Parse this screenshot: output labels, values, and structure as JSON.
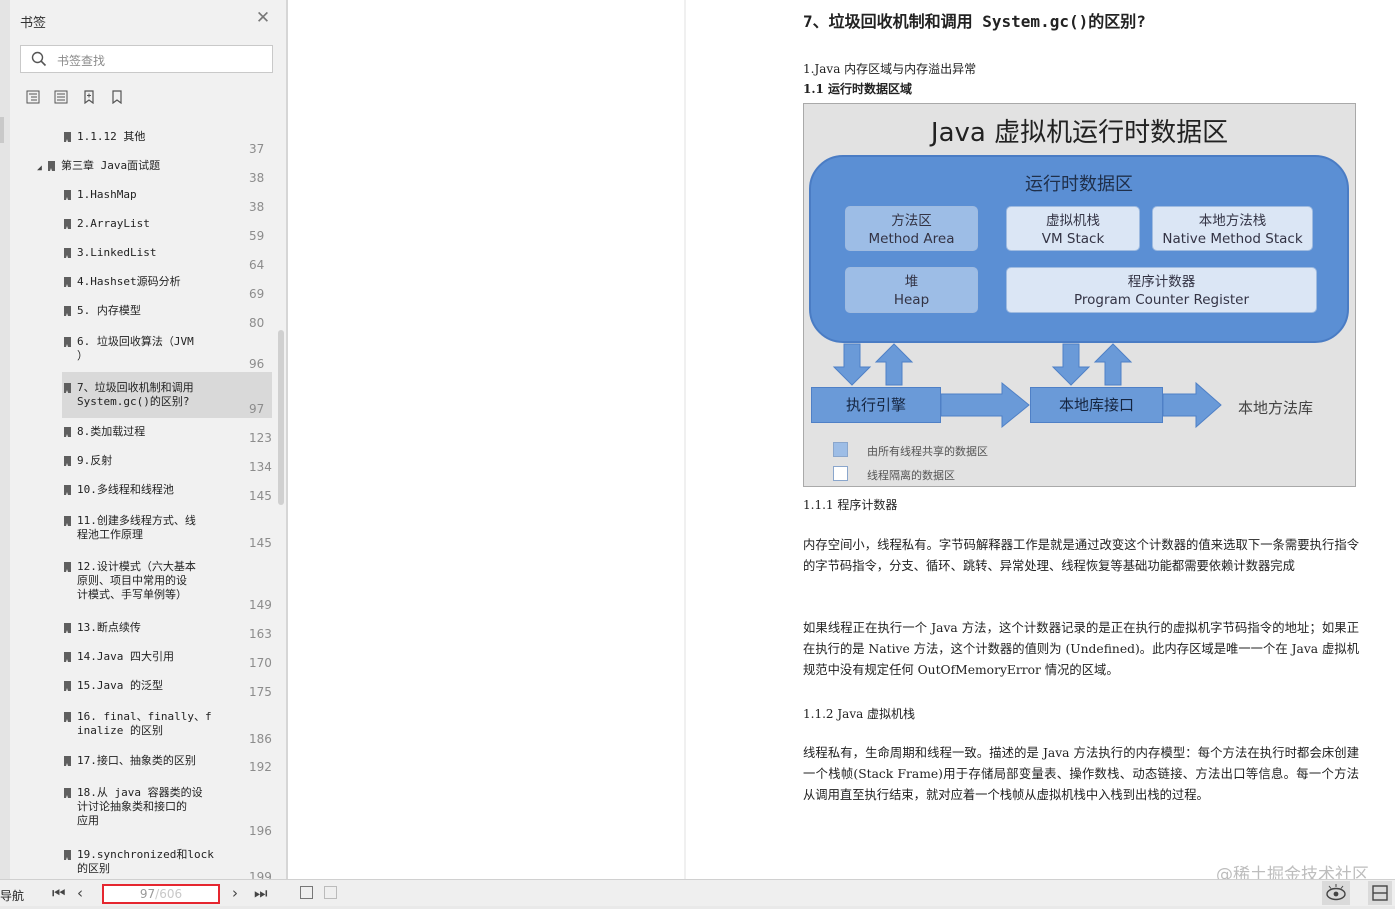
{
  "sidebar": {
    "title": "书签",
    "search_placeholder": "书签查找",
    "bookmarks": [
      {
        "label": "1.1.12 其他",
        "page": "37"
      },
      {
        "label": "第三章 Java面试题",
        "page": "38"
      },
      {
        "label": "1.HashMap",
        "page": "38"
      },
      {
        "label": "2.ArrayList",
        "page": "59"
      },
      {
        "label": "3.LinkedList",
        "page": "64"
      },
      {
        "label": "4.Hashset源码分析",
        "page": "69"
      },
      {
        "label": "5. 内存模型",
        "page": "80"
      },
      {
        "label": "6. 垃圾回收算法（JVM\n）",
        "page": "96"
      },
      {
        "label": "7、垃圾回收机制和调用\nSystem.gc()的区别?",
        "page": "97"
      },
      {
        "label": "8.类加载过程",
        "page": "123"
      },
      {
        "label": "9.反射",
        "page": "134"
      },
      {
        "label": "10.多线程和线程池",
        "page": "145"
      },
      {
        "label": "11.创建多线程方式、线\n程池工作原理",
        "page": "145"
      },
      {
        "label": "12.设计模式（六大基本\n原则、项目中常用的设\n计模式、手写单例等）",
        "page": "149"
      },
      {
        "label": "13.断点续传",
        "page": "163"
      },
      {
        "label": "14.Java 四大引用",
        "page": "170"
      },
      {
        "label": "15.Java 的泛型",
        "page": "175"
      },
      {
        "label": "16. final、finally、f\ninalize 的区别",
        "page": "186"
      },
      {
        "label": "17.接口、抽象类的区别",
        "page": "192"
      },
      {
        "label": "18.从 java 容器类的设\n计讨论抽象类和接口的\n应用",
        "page": "196"
      },
      {
        "label": "19.synchronized和lock\n的区别",
        "page": "199"
      }
    ]
  },
  "document": {
    "heading": "7、垃圾回收机制和调用 System.gc()的区别?",
    "section_1": "1.Java 内存区域与内存溢出异常",
    "section_1_1": "1.1  运行时数据区域",
    "figure": {
      "title": "Java 虚拟机运行时数据区",
      "runtime_area": "运行时数据区",
      "method_area": "方法区\nMethod Area",
      "vm_stack": "虚拟机栈\nVM Stack",
      "native_stack": "本地方法栈\nNative Method Stack",
      "heap": "堆\nHeap",
      "pc_register": "程序计数器\nProgram Counter Register",
      "exec_engine": "执行引擎",
      "native_interface": "本地库接口",
      "native_library": "本地方法库",
      "legend_shared": "由所有线程共享的数据区",
      "legend_private": "线程隔离的数据区"
    },
    "section_1_1_1": "1.1.1  程序计数器",
    "para_1": "内存空间小，线程私有。字节码解释器工作是就是通过改变这个计数器的值来选取下一条需要执行指令的字节码指令，分支、循环、跳转、异常处理、线程恢复等基础功能都需要依赖计数器完成",
    "para_2": "如果线程正在执行一个 Java 方法，这个计数器记录的是正在执行的虚拟机字节码指令的地址；如果正在执行的是 Native 方法，这个计数器的值则为 (Undefined)。此内存区域是唯一一个在 Java 虚拟机规范中没有规定任何 OutOfMemoryError 情况的区域。",
    "section_1_1_2": "1.1.2 Java  虚拟机栈",
    "para_3": "线程私有，生命周期和线程一致。描述的是 Java 方法执行的内存模型：每个方法在执行时都会床创建一个栈帧(Stack Frame)用于存储局部变量表、操作数栈、动态链接、方法出口等信息。每一个方法从调用直至执行结束，就对应着一个栈帧从虚拟机栈中入栈到出栈的过程。",
    "watermark": "@稀土掘金技术社区"
  },
  "bottom_bar": {
    "nav_label": "导航",
    "current_page": "97",
    "total_pages": "/606"
  },
  "colors": {
    "shared_area": "#9dbde6",
    "private_area": "#dbe6f5",
    "page_box_border": "#e5262f"
  }
}
